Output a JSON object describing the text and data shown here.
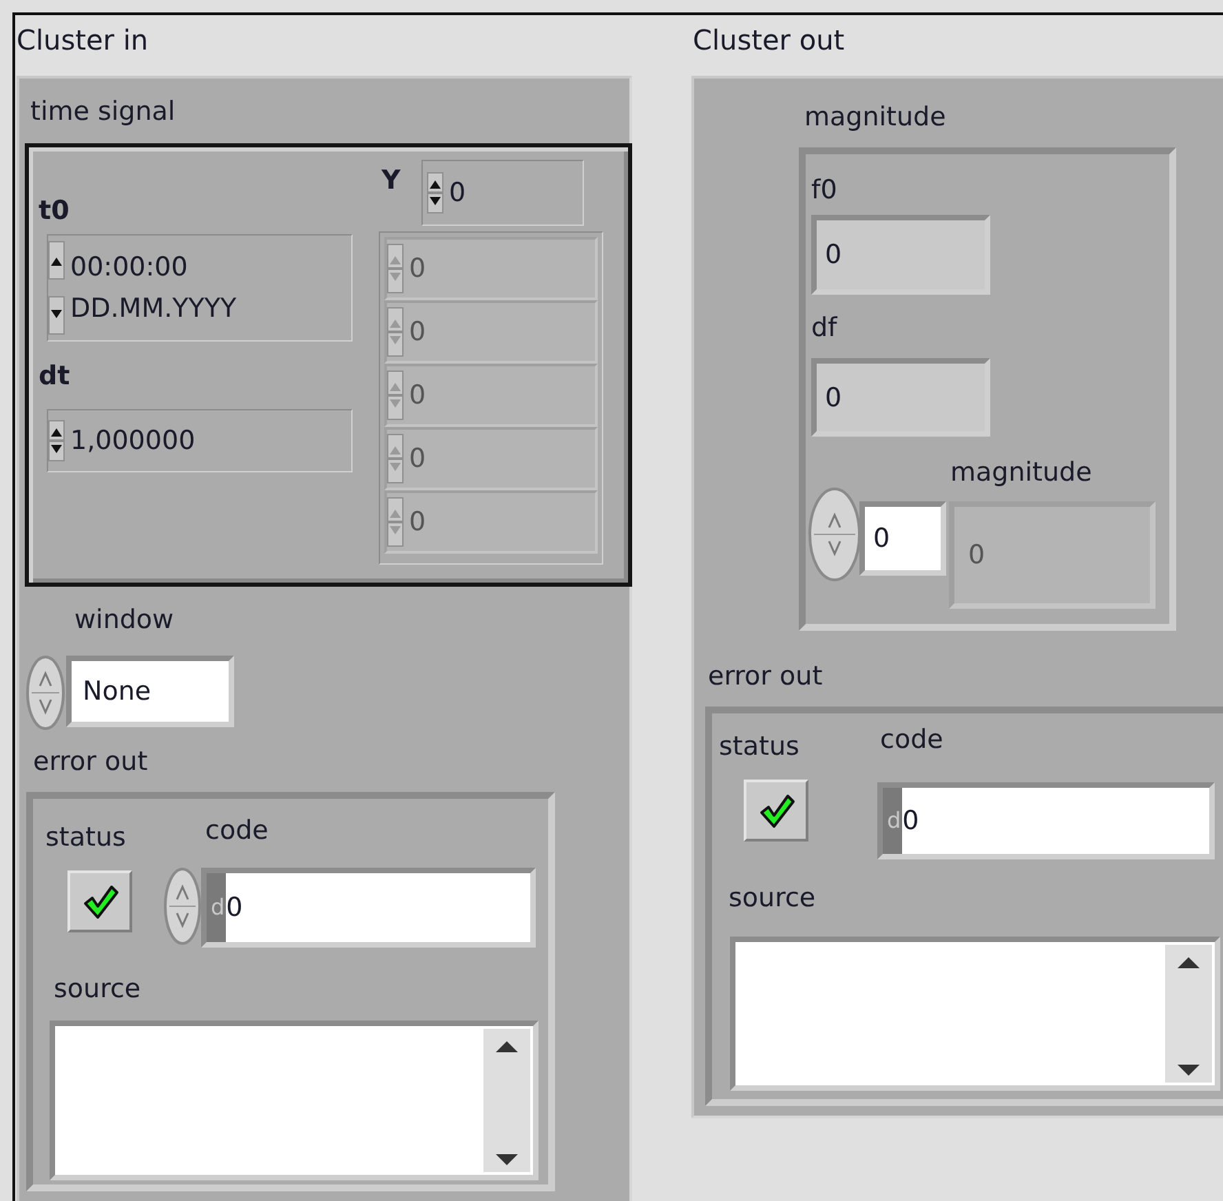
{
  "cluster_in": {
    "label": "Cluster in",
    "time_signal": {
      "label": "time signal",
      "t0": {
        "label": "t0",
        "time": "00:00:00",
        "date": "DD.MM.YYYY"
      },
      "dt": {
        "label": "dt",
        "value": "1,000000"
      },
      "Y": {
        "label": "Y",
        "index": "0",
        "elements": [
          {
            "value": "0",
            "disabled": true
          },
          {
            "value": "0",
            "disabled": true
          },
          {
            "value": "0",
            "disabled": true
          },
          {
            "value": "0",
            "disabled": true
          },
          {
            "value": "0",
            "disabled": true
          }
        ]
      }
    },
    "window": {
      "label": "window",
      "value": "None"
    },
    "error_out": {
      "label": "error out",
      "status": {
        "label": "status",
        "checked": true
      },
      "code": {
        "label": "code",
        "radix": "d",
        "value": "0"
      },
      "source": {
        "label": "source"
      }
    }
  },
  "cluster_out": {
    "label": "Cluster out",
    "magnitude": {
      "label": "magnitude",
      "f0": {
        "label": "f0",
        "value": "0"
      },
      "df": {
        "label": "df",
        "value": "0"
      },
      "array": {
        "label": "magnitude",
        "index": "0",
        "element": {
          "value": "0",
          "disabled": true
        }
      }
    },
    "error_out": {
      "label": "error out",
      "status": {
        "label": "status",
        "checked": true
      },
      "code": {
        "label": "code",
        "radix": "d",
        "value": "0"
      },
      "source": {
        "label": "source"
      }
    }
  }
}
